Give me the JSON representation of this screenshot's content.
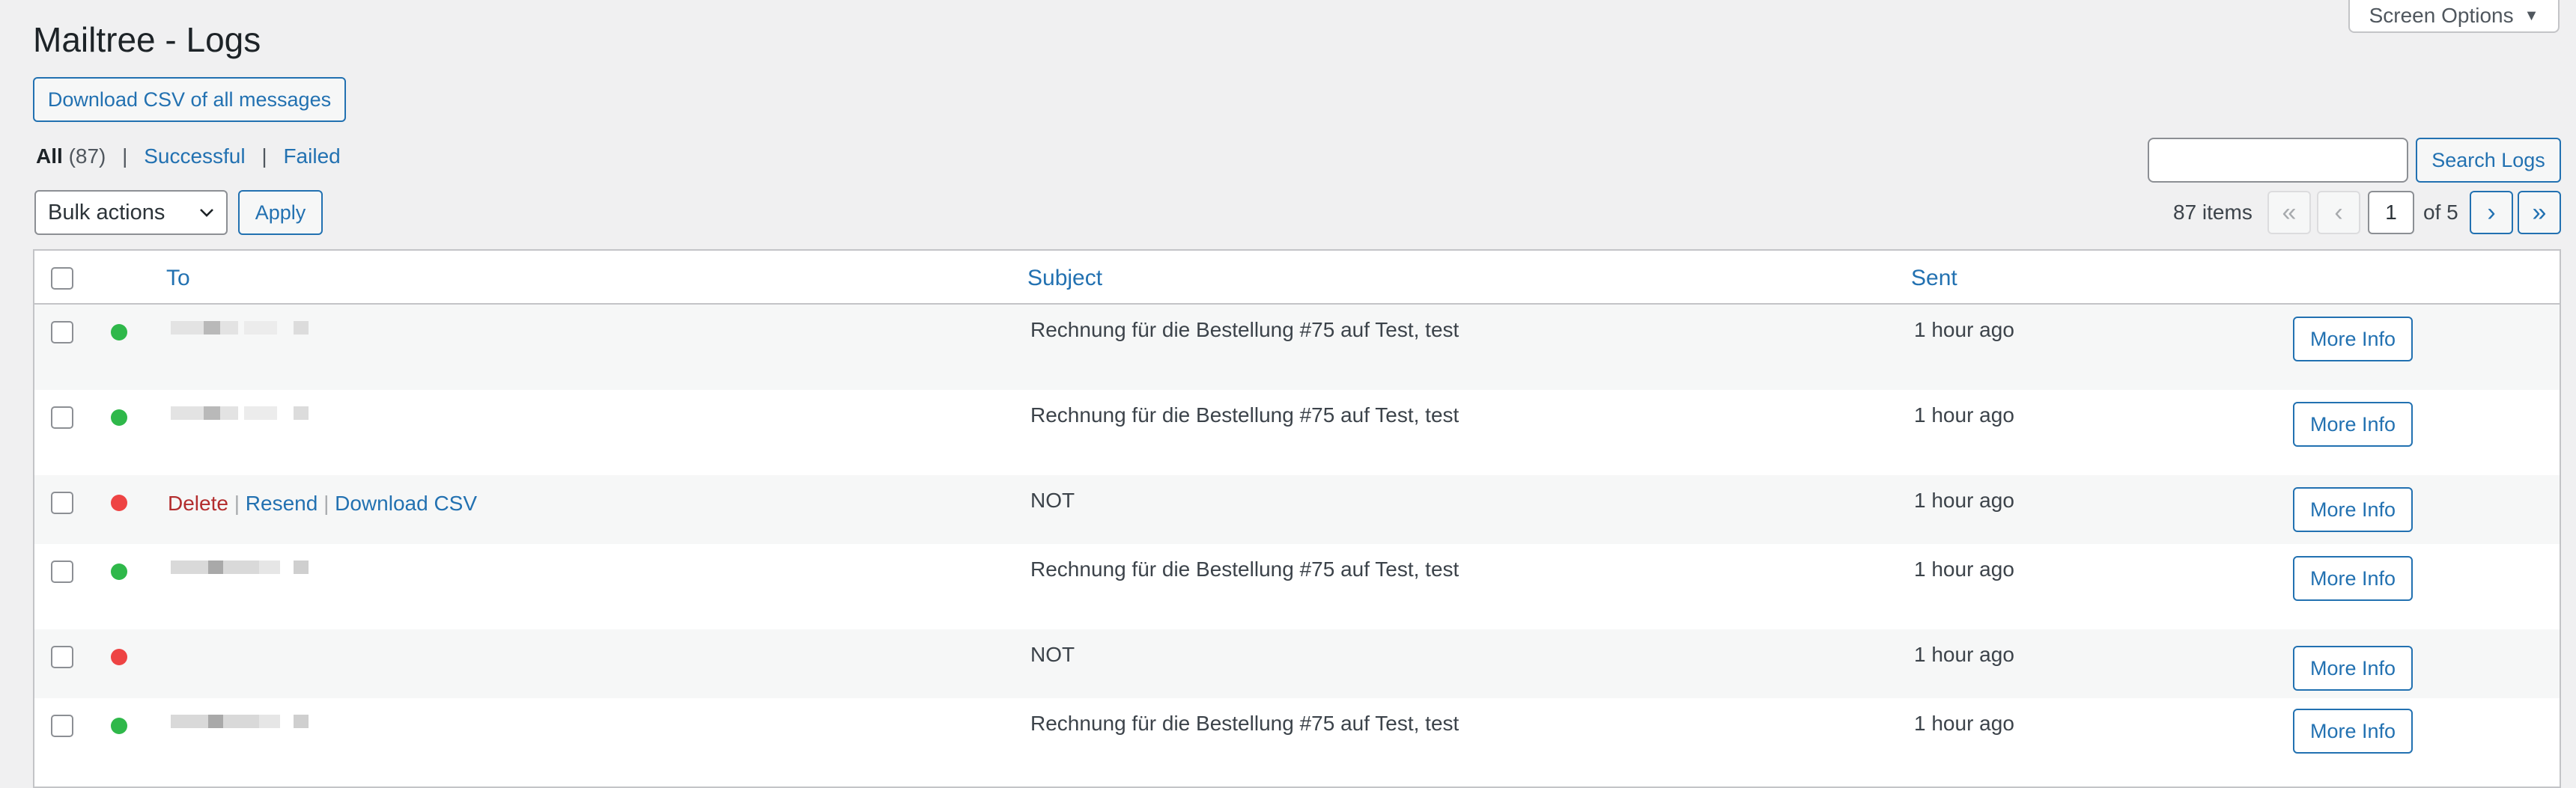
{
  "page": {
    "title": "Mailtree - Logs",
    "screen_options_label": "Screen Options",
    "download_csv_label": "Download CSV of all messages"
  },
  "filters": {
    "all_label": "All",
    "all_count": "(87)",
    "successful_label": "Successful",
    "failed_label": "Failed",
    "separator": "|"
  },
  "search": {
    "value": "",
    "button_label": "Search Logs"
  },
  "bulk": {
    "selected": "Bulk actions",
    "apply_label": "Apply"
  },
  "pagination": {
    "items": "87 items",
    "first": "«",
    "prev": "‹",
    "current_page": "1",
    "of_total": "of 5",
    "next": "›",
    "last": "»"
  },
  "table": {
    "columns": [
      "To",
      "Subject",
      "Sent"
    ],
    "row_actions": {
      "delete": "Delete",
      "resend": "Resend",
      "download": "Download CSV",
      "sep": "|"
    },
    "rows": [
      {
        "status": "success",
        "status_color": "#2fb84a",
        "subject": "Rechnung für die Bestellung #75 auf Test, test",
        "sent": "1 hour ago",
        "action": "More Info"
      },
      {
        "status": "success",
        "status_color": "#2fb84a",
        "subject": "Rechnung für die Bestellung #75 auf Test, test",
        "sent": "1 hour ago",
        "action": "More Info"
      },
      {
        "status": "failed",
        "status_color": "#ee4444",
        "subject": "NOT",
        "sent": "1 hour ago",
        "action": "More Info"
      },
      {
        "status": "success",
        "status_color": "#2fb84a",
        "subject": "Rechnung für die Bestellung #75 auf Test, test",
        "sent": "1 hour ago",
        "action": "More Info"
      },
      {
        "status": "failed",
        "status_color": "#ee4444",
        "subject": "NOT",
        "sent": "1 hour ago",
        "action": "More Info"
      },
      {
        "status": "success",
        "status_color": "#2fb84a",
        "subject": "Rechnung für die Bestellung #75 auf Test, test",
        "sent": "1 hour ago",
        "action": "More Info"
      }
    ]
  },
  "colors": {
    "link": "#2271b1",
    "delete": "#b32d2e",
    "success": "#2fb84a",
    "failed": "#ee4444"
  }
}
